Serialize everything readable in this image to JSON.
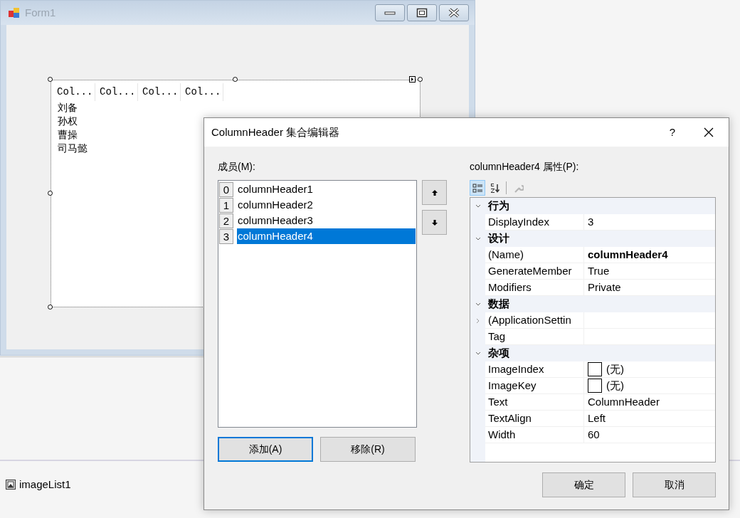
{
  "form": {
    "title": "Form1",
    "listview": {
      "columns": [
        "Col...",
        "Col...",
        "Col...",
        "Col..."
      ],
      "rows": [
        "刘备",
        "孙权",
        "曹操",
        "司马懿"
      ]
    }
  },
  "dialog": {
    "title": "ColumnHeader 集合编辑器",
    "help": "?",
    "members_label": "成员(M):",
    "members": [
      {
        "index": "0",
        "name": "columnHeader1",
        "selected": false
      },
      {
        "index": "1",
        "name": "columnHeader2",
        "selected": false
      },
      {
        "index": "2",
        "name": "columnHeader3",
        "selected": false
      },
      {
        "index": "3",
        "name": "columnHeader4",
        "selected": true
      }
    ],
    "add_button": "添加(A)",
    "remove_button": "移除(R)",
    "properties_label": "columnHeader4 属性(P):",
    "toolbar": [
      {
        "kind": "categorized",
        "selected": true,
        "disabled": false
      },
      {
        "kind": "alphabetical",
        "selected": false,
        "disabled": false
      },
      {
        "kind": "pages",
        "selected": false,
        "disabled": true
      }
    ],
    "categories": [
      {
        "name": "行为",
        "expanded": true,
        "children": [
          {
            "name": "DisplayIndex",
            "value": "3",
            "kind": "text",
            "modified": false
          }
        ]
      },
      {
        "name": "设计",
        "expanded": true,
        "children": [
          {
            "name": "(Name)",
            "value": "columnHeader4",
            "kind": "text",
            "modified": true
          },
          {
            "name": "GenerateMember",
            "value": "True",
            "kind": "text",
            "modified": false
          },
          {
            "name": "Modifiers",
            "value": "Private",
            "kind": "text",
            "modified": false
          }
        ]
      },
      {
        "name": "数据",
        "expanded": true,
        "children": [
          {
            "name": "(ApplicationSettin",
            "kind": "group"
          },
          {
            "name": "Tag",
            "kind": "text"
          }
        ]
      },
      {
        "name": "杂项",
        "expanded": true,
        "children": [
          {
            "name": "ImageIndex",
            "value": "(无)",
            "kind": "image",
            "modified": false
          },
          {
            "name": "ImageKey",
            "value": "(无)",
            "kind": "image",
            "modified": false
          },
          {
            "name": "Text",
            "value": "ColumnHeader",
            "kind": "text",
            "modified": false
          },
          {
            "name": "TextAlign",
            "value": "Left",
            "kind": "text",
            "modified": false
          },
          {
            "name": "Width",
            "value": "60",
            "kind": "text",
            "modified": false
          }
        ]
      }
    ],
    "ok_button": "确定",
    "cancel_button": "取消"
  },
  "tray": [
    {
      "name": "imageList1"
    }
  ]
}
